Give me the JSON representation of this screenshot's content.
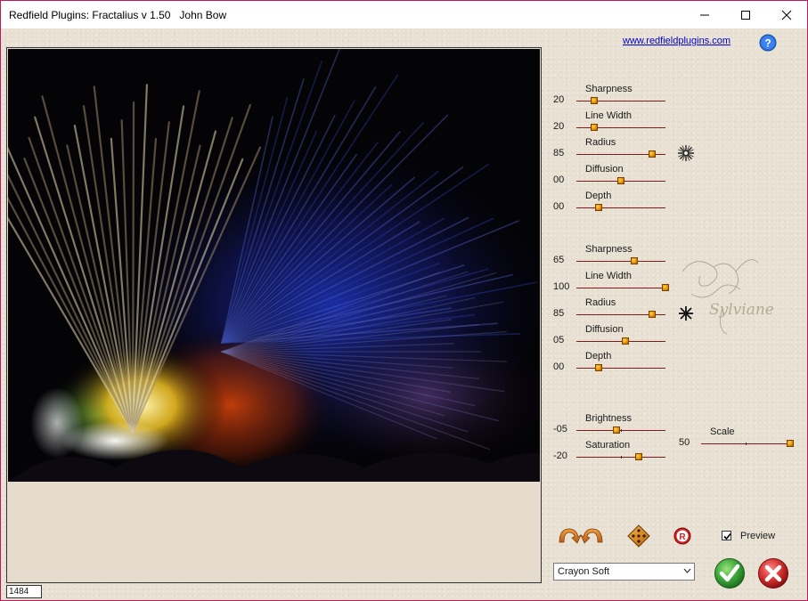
{
  "window": {
    "title": "Redfield Plugins: Fractalius v 1.50   John Bow",
    "controls": [
      "minimize-icon",
      "maximize-icon",
      "close-icon"
    ]
  },
  "header": {
    "link_text": "www.redfieldplugins.com",
    "help_icon": "help-icon"
  },
  "group1": {
    "sliders": [
      {
        "label": "Sharpness",
        "value": "20",
        "level": 0.2
      },
      {
        "label": "Line Width",
        "value": "20",
        "level": 0.2
      },
      {
        "label": "Radius",
        "value": "85",
        "level": 0.85
      },
      {
        "label": "Diffusion",
        "value": "00",
        "level": 0.5
      },
      {
        "label": "Depth",
        "value": "00",
        "level": 0.25
      }
    ],
    "icon": "asterisk-icon"
  },
  "group2": {
    "sliders": [
      {
        "label": "Sharpness",
        "value": "65",
        "level": 0.65
      },
      {
        "label": "Line Width",
        "value": "100",
        "level": 1.0
      },
      {
        "label": "Radius",
        "value": "85",
        "level": 0.85
      },
      {
        "label": "Diffusion",
        "value": "05",
        "level": 0.55
      },
      {
        "label": "Depth",
        "value": "00",
        "level": 0.25
      }
    ],
    "icon": "asterisk-icon"
  },
  "group3": {
    "sliders": [
      {
        "label": "Brightness",
        "value": "-05",
        "level": 0.45
      },
      {
        "label": "Saturation",
        "value": "-20",
        "level": 0.7
      }
    ],
    "scale": {
      "label": "Scale",
      "value": "50",
      "level": 1.0
    }
  },
  "toolbar": {
    "undo_redo_icon": "undo-redo-arrows-icon",
    "random_icon": "dice-icon",
    "reset_icon": "reset-icon",
    "preview_label": "Preview",
    "preview_checked": true
  },
  "preset": {
    "selected": "Crayon Soft"
  },
  "actions": {
    "ok_icon": "ok-checkmark-icon",
    "cancel_icon": "cancel-x-icon"
  },
  "status": {
    "value": "1484"
  },
  "watermark_text": "Sylviane",
  "colors": {
    "accent_track": "#7a1c1c",
    "thumb": "#e58f00",
    "ok": "#3aa53a",
    "cancel": "#d32f2f",
    "link": "#0000cc"
  }
}
